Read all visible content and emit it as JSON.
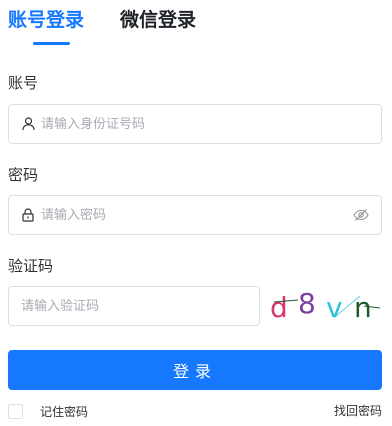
{
  "tabs": [
    {
      "label": "账号登录",
      "active": true
    },
    {
      "label": "微信登录",
      "active": false
    }
  ],
  "account": {
    "label": "账号",
    "placeholder": "请输入身份证号码",
    "icon": "user-icon"
  },
  "password": {
    "label": "密码",
    "placeholder": "请输入密码",
    "icon": "lock-icon",
    "toggle_icon": "eye-hidden-icon"
  },
  "captcha": {
    "label": "验证码",
    "placeholder": "请输入验证码",
    "chars": [
      {
        "char": "d",
        "color": "#d9376e"
      },
      {
        "char": "8",
        "color": "#7b3fa0"
      },
      {
        "char": "v",
        "color": "#2ec4d6"
      },
      {
        "char": "n",
        "color": "#1f5a2e"
      }
    ]
  },
  "submit_label": "登录",
  "remember_label": "记住密码",
  "forgot_label": "找回密码",
  "colors": {
    "accent": "#1677ff",
    "border": "#dcdfe6",
    "placeholder": "#a8abb2"
  }
}
